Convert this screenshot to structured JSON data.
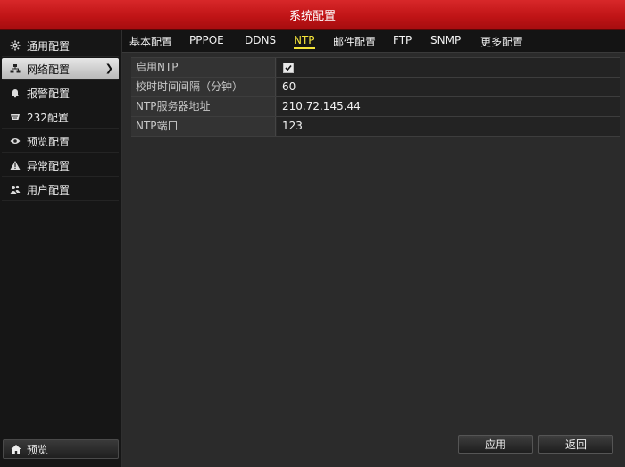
{
  "window": {
    "title": "系统配置"
  },
  "sidebar": {
    "items": [
      {
        "label": "通用配置",
        "icon": "gear-icon"
      },
      {
        "label": "网络配置",
        "icon": "network-icon",
        "active": true
      },
      {
        "label": "报警配置",
        "icon": "bell-icon"
      },
      {
        "label": "232配置",
        "icon": "serial-port-icon"
      },
      {
        "label": "预览配置",
        "icon": "eye-icon"
      },
      {
        "label": "异常配置",
        "icon": "warning-icon"
      },
      {
        "label": "用户配置",
        "icon": "users-icon"
      }
    ],
    "preview_button": {
      "label": "预览",
      "icon": "home-icon"
    }
  },
  "tabs": [
    {
      "label": "基本配置"
    },
    {
      "label": "PPPOE"
    },
    {
      "label": "DDNS"
    },
    {
      "label": "NTP",
      "active": true
    },
    {
      "label": "邮件配置"
    },
    {
      "label": "FTP"
    },
    {
      "label": "SNMP"
    },
    {
      "label": "更多配置"
    }
  ],
  "ntp": {
    "enable_label": "启用NTP",
    "enable_checked": true,
    "interval_label": "校时时间间隔（分钟）",
    "interval_value": "60",
    "server_label": "NTP服务器地址",
    "server_value": "210.72.145.44",
    "port_label": "NTP端口",
    "port_value": "123"
  },
  "buttons": {
    "apply": "应用",
    "back": "返回"
  },
  "colors": {
    "title_bar": "#c01416",
    "active_tab": "#f3e33a",
    "active_sidebar": "#d0d0d0"
  }
}
